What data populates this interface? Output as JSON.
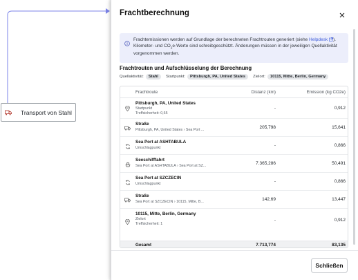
{
  "canvas": {
    "node_label": "Transport von Stahl",
    "node_icon": "truck-icon"
  },
  "modal": {
    "title": "Frachtberechnung",
    "close_icon": "close-icon"
  },
  "info": {
    "icon": "info-icon",
    "text_before_link": "Frachtemissionen werden auf Grundlage der berechneten Frachtrouten generiert (siehe ",
    "link_text": "Helpdesk",
    "text_after_link": "). Kilometer- und CO",
    "co2_sub": "2",
    "text_rest": "e-Werte sind schreibgeschützt. Änderungen müssen in der jeweiligen Quellaktivität vorgenommen werden."
  },
  "section": {
    "title": "Frachtrouten und Aufschlüsselung der Berechnung",
    "source_label": "Quellaktivität:",
    "source_value": "Stahl",
    "start_label": "Startpunkt:",
    "start_value": "Pittsburgh, PA, United States",
    "dest_label": "Zielort:",
    "dest_value": "10115, Mitte, Berlin, Germany"
  },
  "table": {
    "headers": {
      "route": "Frachtroute",
      "distance": "Distanz (km)",
      "emission": "Emission (kg CO2e)"
    },
    "rows": [
      {
        "icon": "location-pin-icon",
        "name": "Pittsburgh, PA, United States",
        "sub1": "Startpunkt",
        "sub2": "Treffsicherheit: 0,65",
        "distance": "-",
        "emission": "0,912"
      },
      {
        "icon": "truck-icon",
        "name": "Straße",
        "sub1": "Pittsburgh, PA, United States › Sea Port ...",
        "sub2": "",
        "distance": "205,798",
        "emission": "15,641"
      },
      {
        "icon": "transfer-icon",
        "name": "Sea Port at ASHTABULA",
        "sub1": "Umschlagpunkt",
        "sub2": "",
        "distance": "-",
        "emission": "0,866"
      },
      {
        "icon": "ship-icon",
        "name": "Seeschifffahrt",
        "sub1": "Sea Port at ASHTABULA › Sea Port at SZ...",
        "sub2": "",
        "distance": "7.365,286",
        "emission": "50,491"
      },
      {
        "icon": "transfer-icon",
        "name": "Sea Port at SZCZECIN",
        "sub1": "Umschlagpunkt",
        "sub2": "",
        "distance": "-",
        "emission": "0,866"
      },
      {
        "icon": "truck-icon",
        "name": "Straße",
        "sub1": "Sea Port at SZCZECIN › 10115, Mitte, B...",
        "sub2": "",
        "distance": "142,69",
        "emission": "13,447"
      },
      {
        "icon": "location-pin-icon",
        "name": "10115, Mitte, Berlin, Germany",
        "sub1": "Zielort",
        "sub2": "Treffsicherheit: 1",
        "distance": "-",
        "emission": "0,912"
      }
    ],
    "total": {
      "label": "Gesamt",
      "distance": "7.713,774",
      "emission": "83,135"
    }
  },
  "footer": {
    "close_label": "Schließen"
  },
  "colors": {
    "accent": "#7b83e8",
    "link": "#3d5bd9",
    "info_bg": "#eceefb"
  }
}
